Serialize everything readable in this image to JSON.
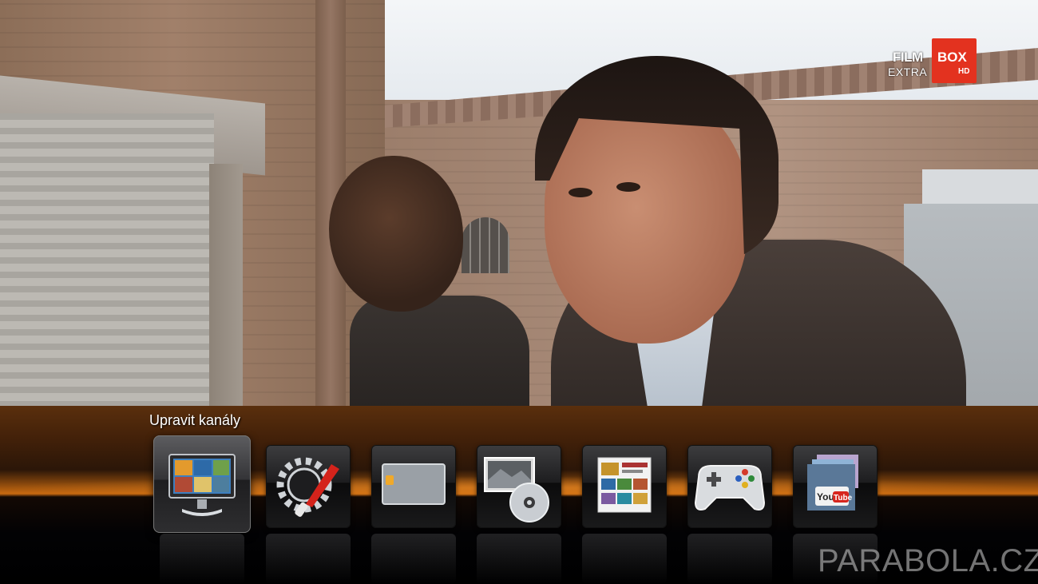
{
  "channel_logo": {
    "line1": "FILM",
    "line1_box": "BOX",
    "line2": "EXTRA",
    "badge": "HD",
    "brand_color": "#e3321f"
  },
  "menu": {
    "title": "Upravit kanály",
    "accent_color": "#c86a10",
    "items": [
      {
        "icon": "tv-monitor-icon",
        "selected": true
      },
      {
        "icon": "settings-tools-icon",
        "selected": false
      },
      {
        "icon": "smart-card-icon",
        "selected": false
      },
      {
        "icon": "media-disc-icon",
        "selected": false
      },
      {
        "icon": "photo-gallery-icon",
        "selected": false
      },
      {
        "icon": "gamepad-icon",
        "selected": false
      },
      {
        "icon": "youtube-icon",
        "selected": false
      }
    ],
    "youtube_label": "You",
    "youtube_label2": "Tube"
  },
  "watermark": "PARABOLA.CZ"
}
